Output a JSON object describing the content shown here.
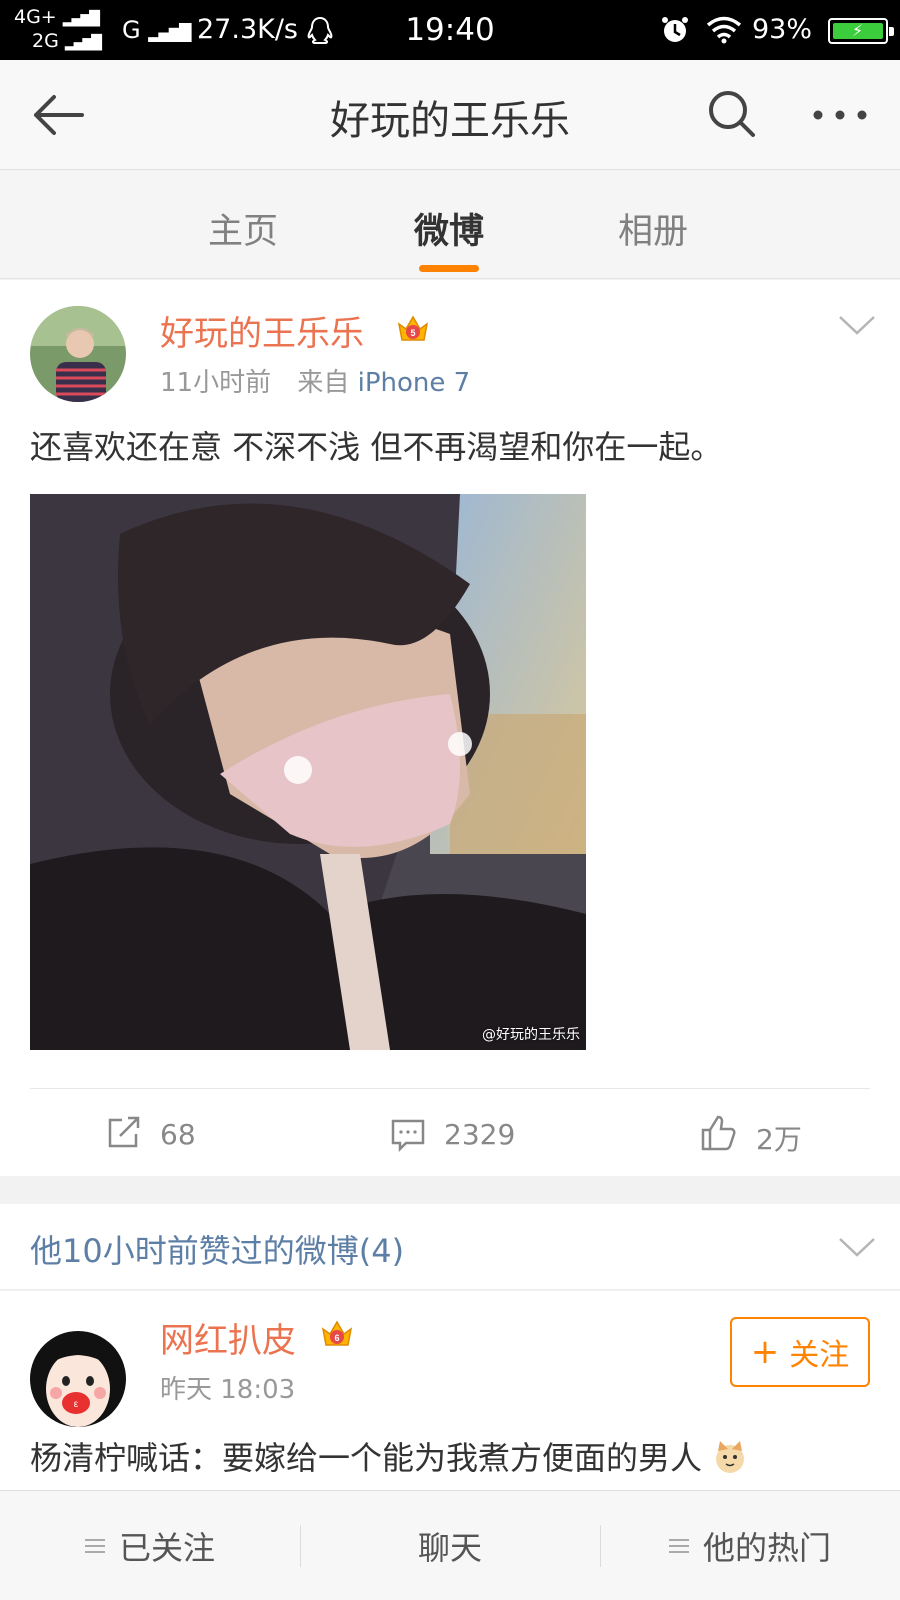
{
  "status_bar": {
    "network_top": "4G+",
    "network_bottom": "2G",
    "signal_g": "G",
    "speed": "27.3K/s",
    "time": "19:40",
    "battery": "93%"
  },
  "header": {
    "title": "好玩的王乐乐"
  },
  "tabs": [
    {
      "label": "主页"
    },
    {
      "label": "微博"
    },
    {
      "label": "相册"
    }
  ],
  "active_tab": "微博",
  "post": {
    "username": "好玩的王乐乐",
    "time": "11小时前",
    "source_prefix": "来自",
    "source": "iPhone 7",
    "text": "还喜欢还在意 不深不浅 但不再渴望和你在一起。",
    "image_watermark": "@好玩的王乐乐",
    "reposts": "68",
    "comments": "2329",
    "likes": "2万"
  },
  "liked_section": {
    "title": "他10小时前赞过的微博(4)"
  },
  "liked_post": {
    "username": "网红扒皮",
    "time": "昨天 18:03",
    "follow_label": "关注",
    "text": "杨清柠喊话：要嫁给一个能为我煮方便面的男人"
  },
  "bottom_bar": {
    "following": "已关注",
    "chat": "聊天",
    "hot": "他的热门"
  },
  "colors": {
    "accent_orange": "#ff8200",
    "username_orange": "#eb7350",
    "link_blue": "#5d7fa6"
  }
}
